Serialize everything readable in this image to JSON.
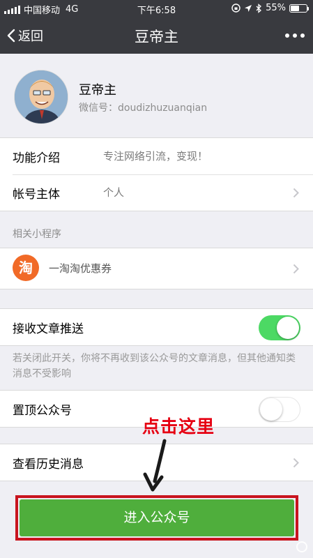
{
  "status_bar": {
    "carrier": "中国移动",
    "network": "4G",
    "time": "下午6:58",
    "battery": "55%",
    "battery_level": 0.55
  },
  "nav": {
    "back_label": "返回",
    "title": "豆帝主"
  },
  "profile": {
    "name": "豆帝主",
    "id_label": "微信号：",
    "id_value": "doudizhuzuanqian"
  },
  "info": {
    "function_label": "功能介绍",
    "function_value": "专注网络引流，变现！",
    "owner_label": "帐号主体",
    "owner_value": "个人"
  },
  "mini_programs": {
    "title": "相关小程序",
    "item_icon_text": "淘",
    "item_label": "一淘淘优惠券"
  },
  "settings": {
    "receive_label": "接收文章推送",
    "receive_on": true,
    "note": "若关闭此开关，你将不再收到该公众号的文章消息，但其他通知类消息不受影响",
    "pin_label": "置顶公众号",
    "pin_on": false,
    "history_label": "查看历史消息"
  },
  "annotation": {
    "text": "点击这里"
  },
  "enter_button": {
    "label": "进入公众号"
  },
  "colors": {
    "header": "#393a3f",
    "toggle_on": "#4cd964",
    "button_green": "#4fae3c",
    "annotation_red": "#e60012"
  }
}
